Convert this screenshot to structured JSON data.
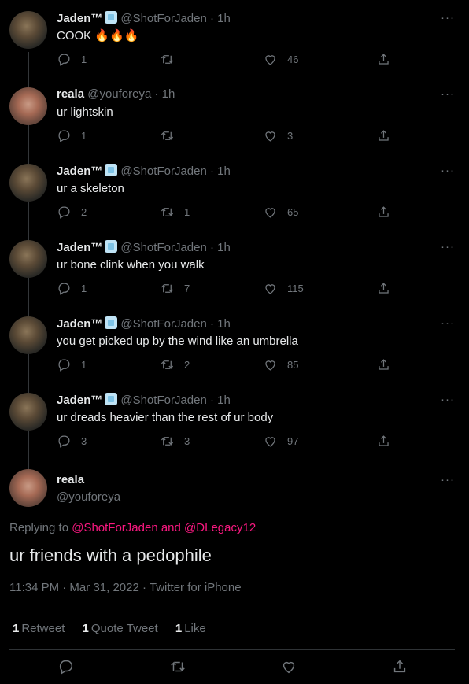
{
  "thread": [
    {
      "name": "Jaden™",
      "badge": "ice-cube-emoji",
      "handle": "@ShotForJaden",
      "dot": "·",
      "time": "1h",
      "text": "COOK 🔥🔥🔥",
      "replies": "1",
      "retweets": "",
      "likes": "46",
      "avatar": "jaden"
    },
    {
      "name": "reala",
      "badge": "",
      "handle": "@youforeya",
      "dot": "·",
      "time": "1h",
      "text": "ur lightskin",
      "replies": "1",
      "retweets": "",
      "likes": "3",
      "avatar": "reala"
    },
    {
      "name": "Jaden™",
      "badge": "ice-cube-emoji",
      "handle": "@ShotForJaden",
      "dot": "·",
      "time": "1h",
      "text": "ur a skeleton",
      "replies": "2",
      "retweets": "1",
      "likes": "65",
      "avatar": "jaden"
    },
    {
      "name": "Jaden™",
      "badge": "ice-cube-emoji",
      "handle": "@ShotForJaden",
      "dot": "·",
      "time": "1h",
      "text": "ur bone clink when you walk",
      "replies": "1",
      "retweets": "7",
      "likes": "115",
      "avatar": "jaden"
    },
    {
      "name": "Jaden™",
      "badge": "ice-cube-emoji",
      "handle": "@ShotForJaden",
      "dot": "·",
      "time": "1h",
      "text": "you get picked up by the wind like an umbrella",
      "replies": "1",
      "retweets": "2",
      "likes": "85",
      "avatar": "jaden"
    },
    {
      "name": "Jaden™",
      "badge": "ice-cube-emoji",
      "handle": "@ShotForJaden",
      "dot": "·",
      "time": "1h",
      "text": "ur dreads heavier than the rest of ur body",
      "replies": "3",
      "retweets": "3",
      "likes": "97",
      "avatar": "jaden"
    }
  ],
  "main": {
    "name": "reala",
    "handle": "@youforeya",
    "replying_prefix": "Replying to",
    "replying_user1": "@ShotForJaden",
    "replying_and": "and",
    "replying_user2": "@DLegacy12",
    "text": "ur friends with a pedophile",
    "meta": "11:34 PM · Mar 31, 2022 · Twitter for iPhone",
    "retweets_count": "1",
    "retweets_label": "Retweet",
    "quotes_count": "1",
    "quotes_label": "Quote Tweet",
    "likes_count": "1",
    "likes_label": "Like"
  },
  "more_glyph": "···",
  "colors": {
    "background": "#000000",
    "text": "#e7e9ea",
    "muted": "#71767b",
    "link": "#f91880",
    "divider": "#2f3336"
  },
  "icons": {
    "reply": "reply-icon",
    "retweet": "retweet-icon",
    "like": "heart-icon",
    "share": "share-icon",
    "more": "more-icon"
  }
}
